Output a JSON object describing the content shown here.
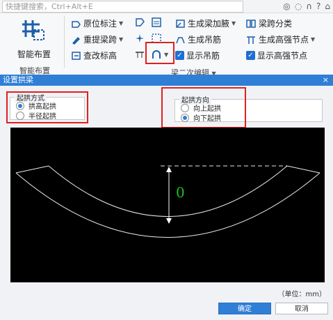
{
  "top_bar": {
    "search_placeholder": "快捷键搜索，Ctrl+Alt+E",
    "icons": [
      "user-icon",
      "chat-icon",
      "headset-icon",
      "help-icon",
      "shirt-icon"
    ]
  },
  "ribbon": {
    "big_tool_label": "智能布置",
    "group_label": "智能布置",
    "tools": {
      "original_mark": "原位标注",
      "re_extract_span": "重提梁跨",
      "check_elevation": "查改标高",
      "generate_haunch": "生成梁加腋",
      "generate_hanger": "生成吊筋",
      "show_hanger": "显示吊筋",
      "span_classify": "梁跨分类",
      "generate_hs_node": "生成高强节点",
      "show_hs_node": "显示高强节点"
    },
    "section_label": "梁二次编辑"
  },
  "dialog": {
    "title": "设置拱梁",
    "close": "×",
    "arch_mode": {
      "legend": "起拱方式",
      "options": [
        "拱高起拱",
        "半径起拱"
      ],
      "selected": 0
    },
    "arch_direction": {
      "legend": "起拱方向",
      "options": [
        "向上起拱",
        "向下起拱"
      ],
      "selected": 1
    },
    "preview": {
      "dimension_value": "0"
    },
    "unit_label": "（单位：mm）",
    "ok_label": "确定",
    "cancel_label": "取消"
  },
  "colors": {
    "accent": "#2f7fd6",
    "highlight": "#e02020",
    "dimension": "#18c418"
  }
}
